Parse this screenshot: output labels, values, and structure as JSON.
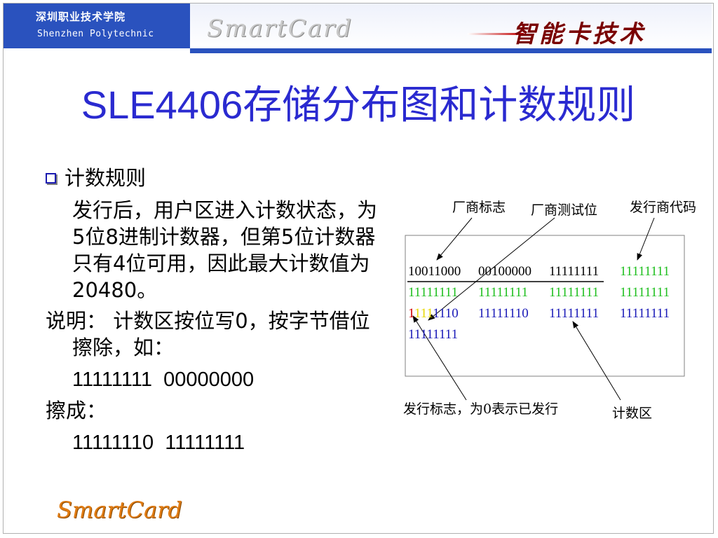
{
  "header": {
    "school_cn": "深圳职业技术学院",
    "school_en": "Shenzhen Polytechnic",
    "wordmark": "SmartCard",
    "tagline": "智能卡技术"
  },
  "title": "SLE4406存储分布图和计数规则",
  "content": {
    "bullet": "计数规则",
    "paragraph": "发行后，用户区进入计数状态，为5位8进制计数器，但第5位计数器只有4位可用，因此最大计数值为20480。",
    "note": "说明： 计数区按位写0，按字节借位擦除，如：",
    "example_before": "11111111  00000000",
    "erase_label": "擦成：",
    "example_after": "11111110  11111111"
  },
  "diagram": {
    "labels": {
      "vendor_mark": "厂商标志",
      "vendor_test": "厂商测试位",
      "issuer_code": "发行商代码",
      "issue_flag": "发行标志，为0表示已发行",
      "counter_area": "计数区"
    },
    "rows": [
      [
        "10011000",
        "00100000",
        "11111111",
        "11111111"
      ],
      [
        "11111111",
        "11111111",
        "11111111",
        "11111111"
      ],
      [
        "11111110",
        "11111110",
        "11111111",
        "11111111"
      ],
      [
        "11111111"
      ]
    ],
    "row3_first_parts": [
      "1",
      "111",
      "1110"
    ],
    "colors": {
      "black": "#000000",
      "green": "#1fbf1f",
      "blue": "#1a1ab8",
      "red": "#d00000",
      "yellow": "#e8d800"
    }
  },
  "footer": {
    "logo": "SmartCard"
  }
}
